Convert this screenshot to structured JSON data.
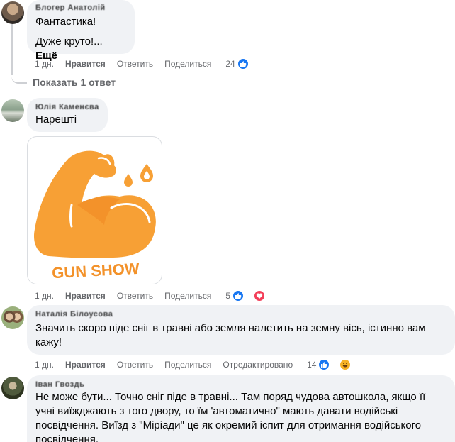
{
  "comments": [
    {
      "author": "Блогер Анатолій",
      "lines": [
        "Фантастика!"
      ],
      "preview": "Дуже круто!...",
      "more": "Ещё",
      "time": "1 дн.",
      "like": "Нравится",
      "reply": "Ответить",
      "share": "Поделиться",
      "count": "24",
      "reactions": [
        "like"
      ]
    },
    {
      "author": "Юлія Каменєва",
      "text": "Нарешті",
      "sticker_text": "GUN SHOW",
      "time": "1 дн.",
      "like": "Нравится",
      "reply": "Ответить",
      "share": "Поделиться",
      "count": "5",
      "reactions": [
        "like",
        "love"
      ]
    },
    {
      "author": "Наталія Білоусова",
      "text": "Значить скоро піде сніг в травні або земля налетить на земну вісь, істинно вам кажу!",
      "time": "1 дн.",
      "like": "Нравится",
      "reply": "Ответить",
      "share": "Поделиться",
      "edited": "Отредактировано",
      "count": "14",
      "reactions": [
        "like",
        "haha"
      ]
    },
    {
      "author": "Іван Гвоздь",
      "text": "Не може бути... Точно сніг піде в травні... Там поряд чудова автошкола, якщо її учні виїжджають з того двору, то їм 'автоматично\" мають давати водійські посвідчення. Виїзд з \"Міріади\" це як окремий іспит для отримання водійського посвідчення."
    }
  ],
  "show_replies": "Показать 1 ответ",
  "colors": {
    "bubble": "#f0f2f5",
    "meta": "#65676b",
    "like": "#1877f2",
    "love": "#f33e58",
    "haha": "#f7b125",
    "sticker_orange": "#f7a035"
  }
}
